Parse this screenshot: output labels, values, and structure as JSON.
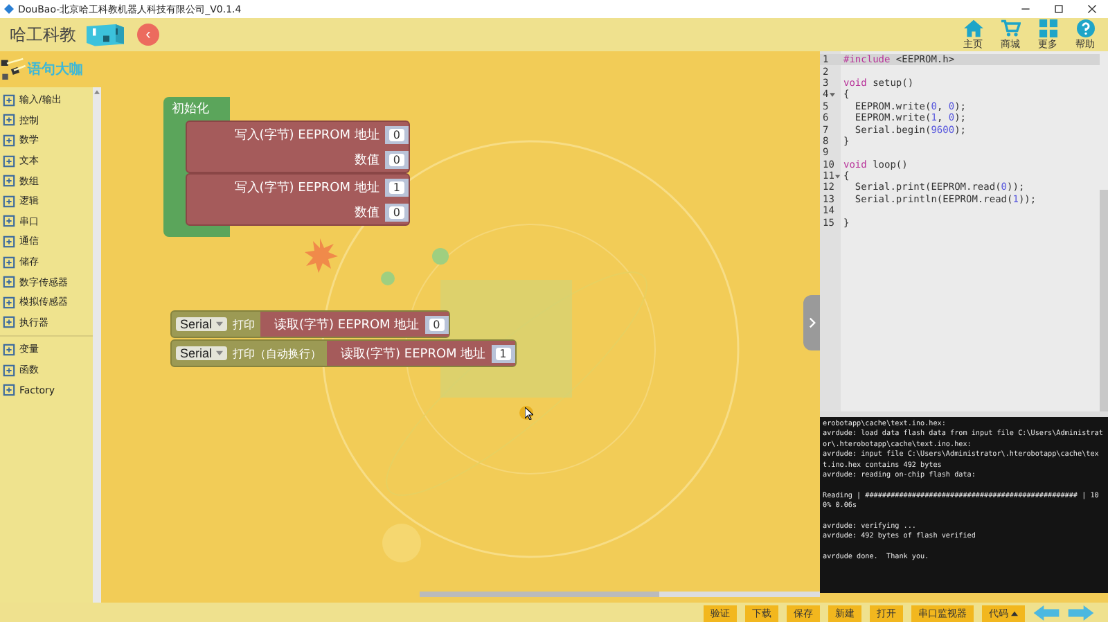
{
  "window": {
    "title": "DouBao-北京哈工科教机器人科技有限公司_V0.1.4"
  },
  "header": {
    "brand": "哈工科教",
    "back": "‹",
    "nav": [
      {
        "kind": "home",
        "label": "主页"
      },
      {
        "kind": "shop",
        "label": "商城"
      },
      {
        "kind": "more",
        "label": "更多"
      },
      {
        "kind": "help",
        "label": "帮助"
      }
    ]
  },
  "toolbox": {
    "title": "语句大咖",
    "groups": [
      {
        "items": [
          "输入/输出",
          "控制",
          "数学",
          "文本",
          "数组",
          "逻辑",
          "串口",
          "通信",
          "储存",
          "数字传感器",
          "模拟传感器",
          "执行器"
        ]
      },
      {
        "items": [
          "变量",
          "函数",
          "Factory"
        ]
      }
    ]
  },
  "workspace": {
    "setup_block": {
      "label": "初始化",
      "blocks": [
        {
          "rows": [
            {
              "label": "写入(字节) EEPROM 地址",
              "value": "0"
            },
            {
              "label": "数值",
              "value": "0"
            }
          ]
        },
        {
          "rows": [
            {
              "label": "写入(字节) EEPROM 地址",
              "value": "1"
            },
            {
              "label": "数值",
              "value": "0"
            }
          ]
        }
      ]
    },
    "serial_blocks": [
      {
        "port": "Serial",
        "label": "打印",
        "read_label": "读取(字节) EEPROM 地址",
        "value": "0"
      },
      {
        "port": "Serial",
        "label": "打印（自动换行）",
        "read_label": "读取(字节) EEPROM 地址",
        "value": "1"
      }
    ]
  },
  "code_editor": {
    "lines": [
      {
        "num": "1",
        "fold": false,
        "selected": true,
        "tokens": [
          {
            "kind": "keyword",
            "text": "#include"
          },
          {
            "kind": "plain",
            "text": " <EEPROM.h>"
          }
        ]
      },
      {
        "num": "2",
        "fold": false,
        "selected": false
      },
      {
        "num": "3",
        "fold": false,
        "selected": false,
        "tokens": [
          {
            "kind": "keyword",
            "text": "void"
          },
          {
            "kind": "plain",
            "text": " setup()"
          }
        ]
      },
      {
        "num": "4",
        "fold": true,
        "selected": false,
        "tokens": [
          {
            "kind": "plain",
            "text": "{"
          }
        ]
      },
      {
        "num": "5",
        "fold": false,
        "selected": false,
        "tokens": [
          {
            "kind": "plain",
            "text": "  EEPROM.write("
          },
          {
            "kind": "number",
            "text": "0"
          },
          {
            "kind": "plain",
            "text": ", "
          },
          {
            "kind": "number",
            "text": "0"
          },
          {
            "kind": "plain",
            "text": ");"
          }
        ]
      },
      {
        "num": "6",
        "fold": false,
        "selected": false,
        "tokens": [
          {
            "kind": "plain",
            "text": "  EEPROM.write("
          },
          {
            "kind": "number",
            "text": "1"
          },
          {
            "kind": "plain",
            "text": ", "
          },
          {
            "kind": "number",
            "text": "0"
          },
          {
            "kind": "plain",
            "text": ");"
          }
        ]
      },
      {
        "num": "7",
        "fold": false,
        "selected": false,
        "tokens": [
          {
            "kind": "plain",
            "text": "  Serial.begin("
          },
          {
            "kind": "number",
            "text": "9600"
          },
          {
            "kind": "plain",
            "text": ");"
          }
        ]
      },
      {
        "num": "8",
        "fold": false,
        "selected": false,
        "tokens": [
          {
            "kind": "plain",
            "text": "}"
          }
        ]
      },
      {
        "num": "9",
        "fold": false,
        "selected": false
      },
      {
        "num": "10",
        "fold": false,
        "selected": false,
        "tokens": [
          {
            "kind": "keyword",
            "text": "void"
          },
          {
            "kind": "plain",
            "text": " loop()"
          }
        ]
      },
      {
        "num": "11",
        "fold": true,
        "selected": false,
        "tokens": [
          {
            "kind": "plain",
            "text": "{"
          }
        ]
      },
      {
        "num": "12",
        "fold": false,
        "selected": false,
        "tokens": [
          {
            "kind": "plain",
            "text": "  Serial.print(EEPROM.read("
          },
          {
            "kind": "number",
            "text": "0"
          },
          {
            "kind": "plain",
            "text": "));"
          }
        ]
      },
      {
        "num": "13",
        "fold": false,
        "selected": false,
        "tokens": [
          {
            "kind": "plain",
            "text": "  Serial.println(EEPROM.read("
          },
          {
            "kind": "number",
            "text": "1"
          },
          {
            "kind": "plain",
            "text": "));"
          }
        ]
      },
      {
        "num": "14",
        "fold": false,
        "selected": false
      },
      {
        "num": "15",
        "fold": false,
        "selected": false,
        "tokens": [
          {
            "kind": "plain",
            "text": "}"
          }
        ]
      }
    ]
  },
  "console": {
    "paragraphs": [
      [
        "erobotapp\\cache\\text.ino.hex:",
        "avrdude: load data flash data from input file C:\\Users\\Administrat",
        "or\\.hterobotapp\\cache\\text.ino.hex:",
        "avrdude: input file C:\\Users\\Administrator\\.hterobotapp\\cache\\tex",
        "t.ino.hex contains 492 bytes",
        "avrdude: reading on-chip flash data:"
      ],
      [
        "Reading | ################################################## | 10",
        "0% 0.06s"
      ],
      [
        "avrdude: verifying ...",
        "avrdude: 492 bytes of flash verified"
      ],
      [
        "avrdude done.  Thank you."
      ]
    ]
  },
  "toolbar": {
    "buttons": [
      {
        "kind": "text",
        "label": "验证"
      },
      {
        "kind": "text",
        "label": "下载"
      },
      {
        "kind": "text",
        "label": "保存"
      },
      {
        "kind": "text",
        "label": "新建"
      },
      {
        "kind": "text",
        "label": "打开"
      },
      {
        "kind": "text",
        "label": "串口监视器"
      },
      {
        "kind": "menu",
        "label": "代码"
      }
    ]
  }
}
